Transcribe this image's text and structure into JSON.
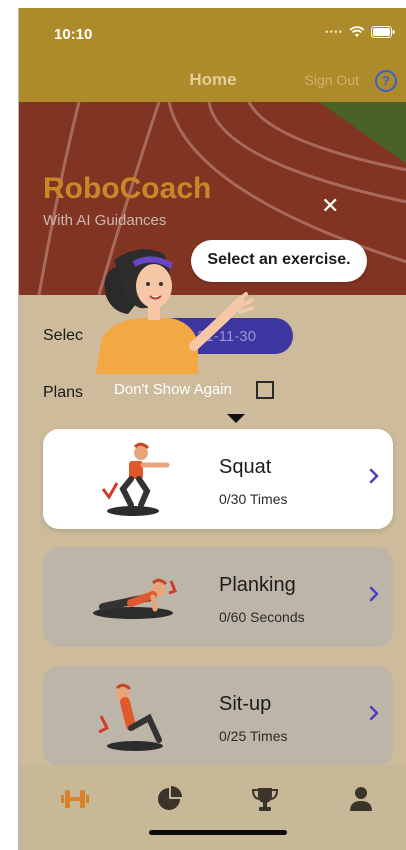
{
  "status_bar": {
    "time": "10:10",
    "signal_icon": "signal-dots-icon",
    "wifi_icon": "wifi-icon",
    "battery_icon": "battery-icon"
  },
  "nav": {
    "title": "Home",
    "sign_out": "Sign Out",
    "help_icon": "help-icon"
  },
  "hero": {
    "title": "RoboCoach",
    "subtitle": "With AI Guidances"
  },
  "select_date": {
    "label": "Selec",
    "date": "21-11-30"
  },
  "plans": {
    "label": "Plans"
  },
  "exercises": [
    {
      "name": "Squat",
      "progress": "0/30 Times"
    },
    {
      "name": "Planking",
      "progress": "0/60 Seconds"
    },
    {
      "name": "Sit-up",
      "progress": "0/25 Times"
    }
  ],
  "tutorial": {
    "bubble_text": "Select an exercise.",
    "dont_show": "Don't Show Again",
    "close_icon": "close-icon"
  },
  "tabs": [
    {
      "icon": "dumbbell-icon"
    },
    {
      "icon": "pie-chart-icon"
    },
    {
      "icon": "trophy-icon"
    },
    {
      "icon": "person-icon"
    }
  ],
  "colors": {
    "accent": "#ad8a2a",
    "date_pill": "#3d35a0",
    "chevron": "#4a3fc8",
    "active_tab": "#d9822b"
  }
}
